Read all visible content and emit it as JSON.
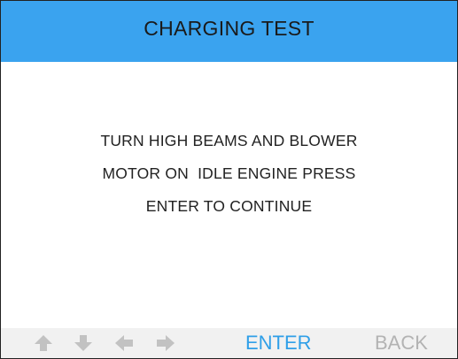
{
  "screen": {
    "title": "CHARGING TEST",
    "message_lines": [
      "TURN HIGH BEAMS AND BLOWER",
      "MOTOR ON  IDLE ENGINE PRESS",
      "ENTER TO CONTINUE"
    ]
  },
  "nav": {
    "arrows": [
      "up-arrow-icon",
      "down-arrow-icon",
      "left-arrow-icon",
      "right-arrow-icon"
    ],
    "enter_label": "ENTER",
    "back_label": "BACK"
  },
  "colors": {
    "title_bar": "#3aa3ef",
    "enter_active": "#2f9fe8",
    "disabled": "#b3b3b3",
    "arrow_disabled": "#c2c2c2"
  }
}
